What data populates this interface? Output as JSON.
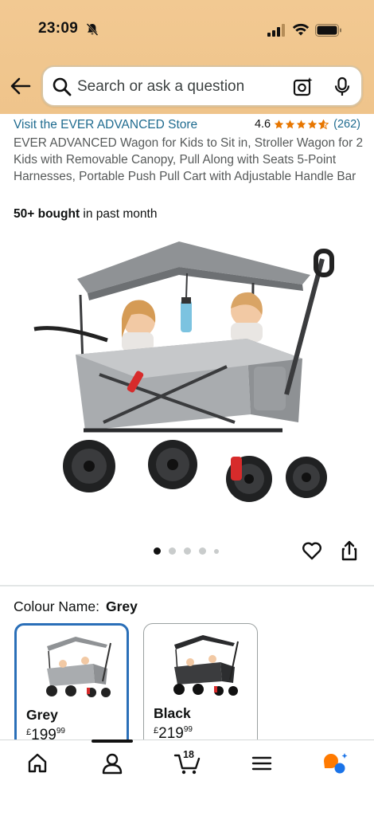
{
  "status": {
    "time": "23:09"
  },
  "search": {
    "placeholder": "Search or ask a question"
  },
  "product": {
    "store_link": "Visit the EVER ADVANCED Store",
    "rating": "4.6",
    "rating_stars": 4.6,
    "rating_count": "(262)",
    "title": "EVER ADVANCED Wagon for Kids to Sit in, Stroller Wagon for 2 Kids with Removable Canopy, Pull Along with Seats 5-Point Harnesses, Portable Push Pull Cart with Adjustable Handle Bar",
    "bought_bold": "50+ bought",
    "bought_rest": " in past month"
  },
  "gallery": {
    "total_images": 5,
    "active_index": 0
  },
  "colour": {
    "label": "Colour Name:",
    "selected": "Grey",
    "options": [
      {
        "name": "Grey",
        "currency": "£",
        "price_whole": "199",
        "price_fraction": "99",
        "selected": true
      },
      {
        "name": "Black",
        "currency": "£",
        "price_whole": "219",
        "price_fraction": "99",
        "selected": false
      }
    ]
  },
  "nav": {
    "items": [
      "home-icon",
      "account-icon",
      "cart-icon",
      "menu-icon",
      "rufus-icon"
    ],
    "cart_count": "18",
    "active": "account-icon"
  },
  "colors": {
    "header": "#efc48b",
    "link": "#1f6b8f",
    "star": "#e77600",
    "selected_border": "#2a6fb8"
  }
}
